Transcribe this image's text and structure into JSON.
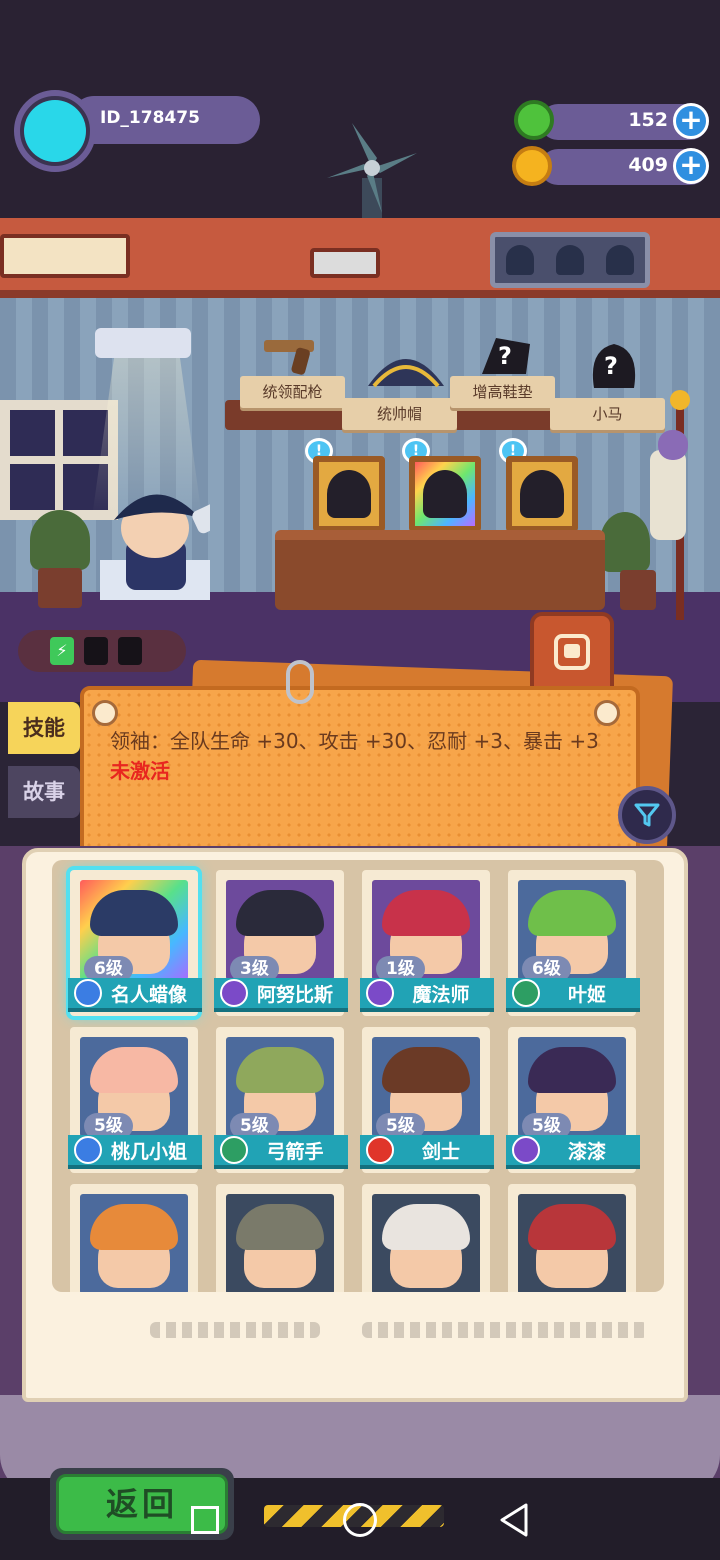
{
  "player": {
    "id": "ID_178475"
  },
  "currency": [
    {
      "name": "green-gem",
      "value": "152",
      "color": "#4fc23c"
    },
    {
      "name": "gold-coin",
      "value": "409",
      "color": "#f5b31f"
    }
  ],
  "shelf_items": [
    {
      "label": "统领配枪",
      "icon": "pistol-icon"
    },
    {
      "label": "统帅帽",
      "icon": "bicorne-hat-icon"
    },
    {
      "label": "增高鞋垫",
      "icon": "unknown-item-icon"
    },
    {
      "label": "小马",
      "icon": "unknown-item-icon"
    }
  ],
  "energy": {
    "charged": 1,
    "total": 3
  },
  "tabs": {
    "skill": "技能",
    "story": "故事"
  },
  "effect": {
    "text": "领袖：全队生命 +30、攻击 +30、忍耐 +3、暴击 +3",
    "status": "未激活"
  },
  "heroes": [
    {
      "level": "6级",
      "name": "名人蜡像",
      "class": "blue",
      "portrait": "rainbow",
      "hair": "#2b3b66",
      "selected": true
    },
    {
      "level": "3级",
      "name": "阿努比斯",
      "class": "purple",
      "portrait": "purple",
      "hair": "#2a2a3a"
    },
    {
      "level": "1级",
      "name": "魔法师",
      "class": "purple",
      "portrait": "purple",
      "hair": "#c8324a"
    },
    {
      "level": "6级",
      "name": "叶姬",
      "class": "green",
      "portrait": "blue",
      "hair": "#6fbf4a"
    },
    {
      "level": "5级",
      "name": "桃几小姐",
      "class": "blue",
      "portrait": "blue",
      "hair": "#f7b8a4"
    },
    {
      "level": "5级",
      "name": "弓箭手",
      "class": "green",
      "portrait": "blue",
      "hair": "#8fa85c"
    },
    {
      "level": "5级",
      "name": "剑士",
      "class": "red",
      "portrait": "blue",
      "hair": "#6b3a26"
    },
    {
      "level": "5级",
      "name": "漆漆",
      "class": "purple",
      "portrait": "blue",
      "hair": "#3a2a55"
    },
    {
      "level": "",
      "name": "",
      "class": "",
      "portrait": "blue",
      "hair": "#e78a3a"
    },
    {
      "level": "",
      "name": "",
      "class": "",
      "portrait": "dark",
      "hair": "#7a7a6a"
    },
    {
      "level": "",
      "name": "",
      "class": "",
      "portrait": "dark",
      "hair": "#e9e4df"
    },
    {
      "level": "",
      "name": "",
      "class": "",
      "portrait": "dark",
      "hair": "#b8363a"
    }
  ],
  "buttons": {
    "back": "返回"
  }
}
